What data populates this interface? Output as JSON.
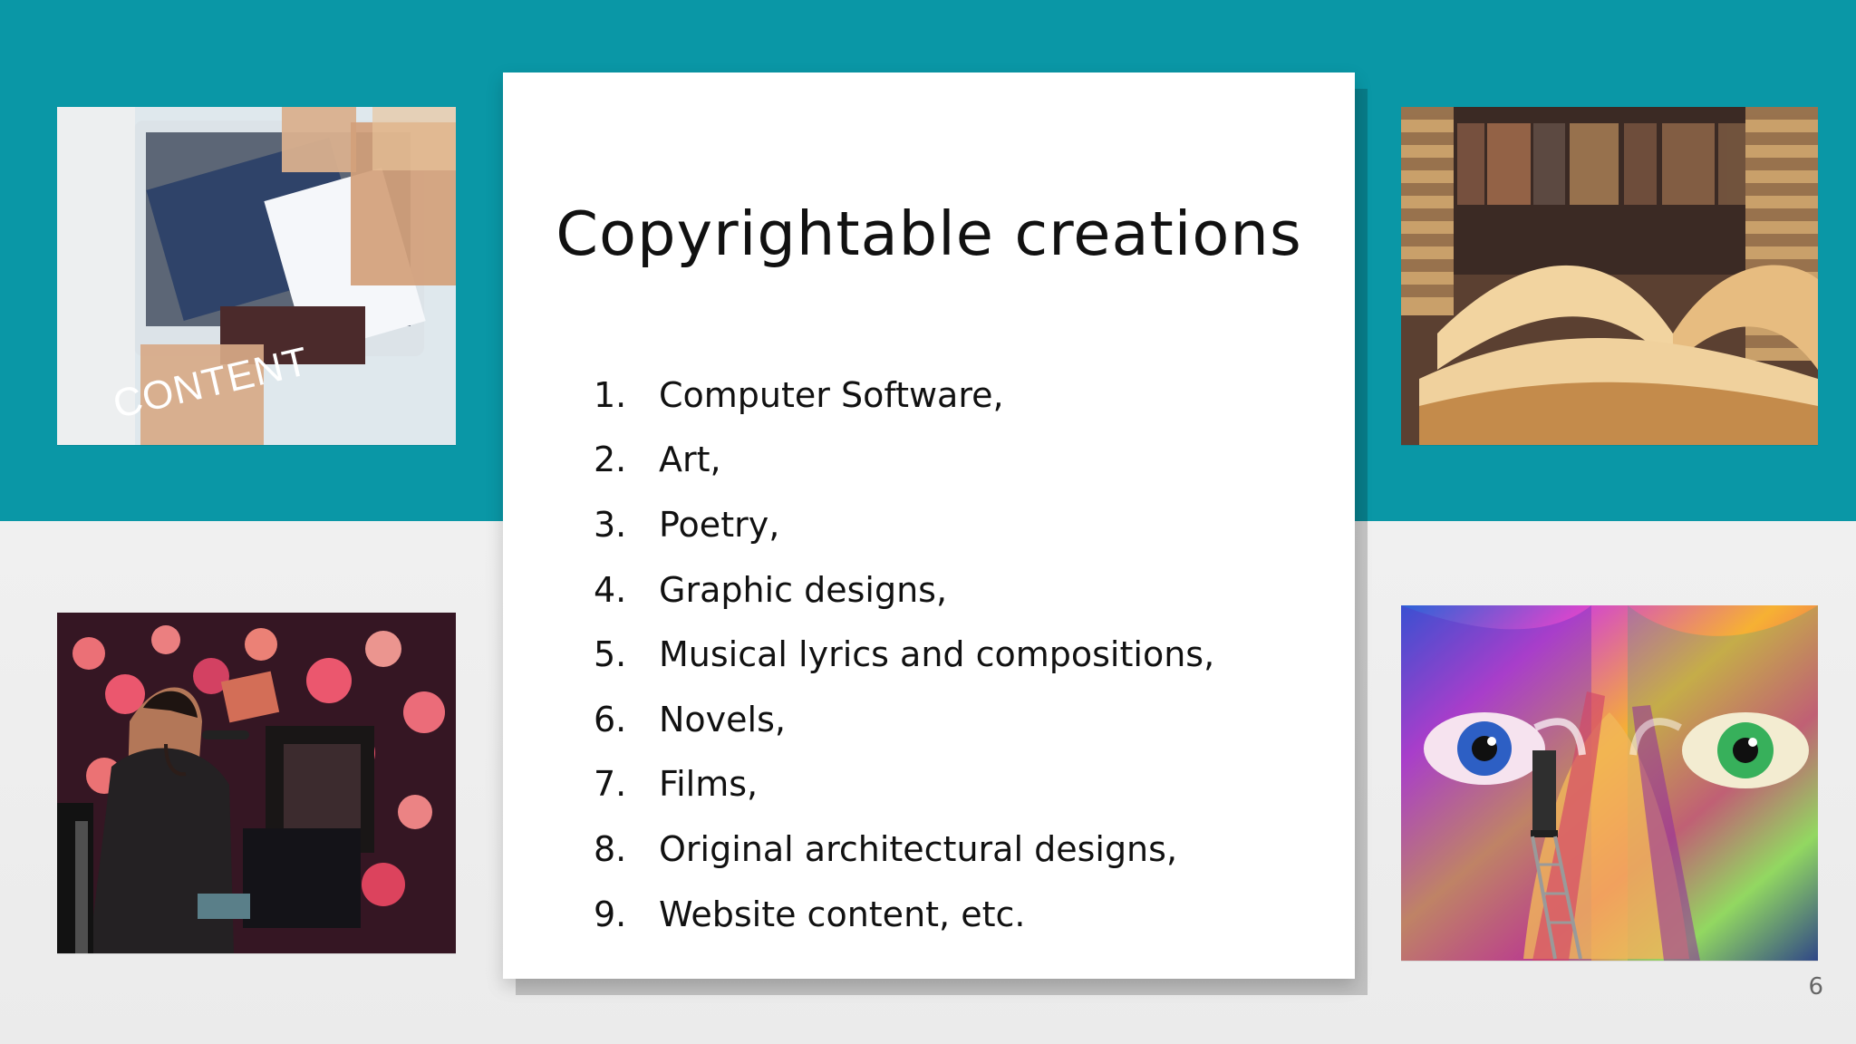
{
  "slide": {
    "title": "Copyrightable creations",
    "items": [
      {
        "number": "1.",
        "text": "Computer Software,"
      },
      {
        "number": "2.",
        "text": "Art,"
      },
      {
        "number": "3.",
        "text": "Poetry,"
      },
      {
        "number": "4.",
        "text": "Graphic designs,"
      },
      {
        "number": "5.",
        "text": "Musical lyrics and compositions,"
      },
      {
        "number": "6.",
        "text": "Novels,"
      },
      {
        "number": "7.",
        "text": "Films,"
      },
      {
        "number": "8.",
        "text": "Original architectural designs,"
      },
      {
        "number": "9.",
        "text": "Website content, etc."
      }
    ],
    "page_number": "6"
  },
  "images": {
    "top_left": {
      "icon": "content-photo",
      "text": "CONTENT"
    },
    "top_right": {
      "icon": "books-photo"
    },
    "bottom_left": {
      "icon": "singer-photo"
    },
    "bottom_right": {
      "icon": "painted-face-photo"
    }
  },
  "colors": {
    "accent": "#0a97a6",
    "background": "#eeeeee",
    "card": "#ffffff",
    "text": "#111111"
  }
}
